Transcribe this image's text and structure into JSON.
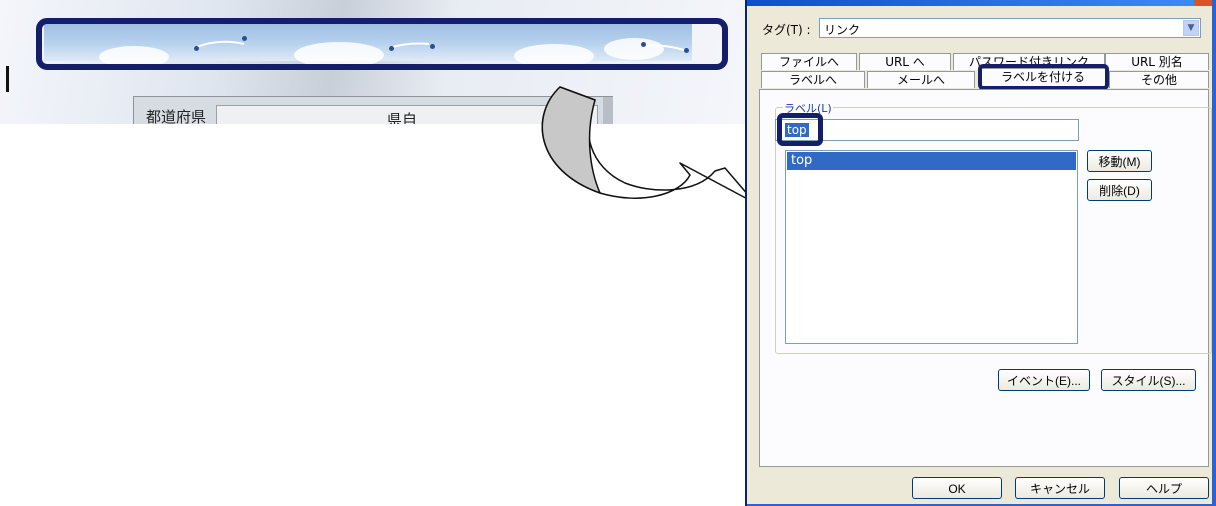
{
  "left_screenshot": {
    "form_header_label": "都道府県",
    "form_value_label": "県自"
  },
  "dialog": {
    "tag_label": "タグ(T) :",
    "tag_value": "リンク",
    "tabs": {
      "row1": [
        "ファイルへ",
        "URL へ",
        "パスワード付きリンク",
        "URL 別名"
      ],
      "row2": [
        "ラベルへ",
        "メールへ",
        "ラベルを付ける",
        "その他"
      ],
      "active": "ラベルを付ける"
    },
    "label_group_title": "ラベル(L)",
    "label_input_value": "top",
    "label_list": [
      "top"
    ],
    "buttons": {
      "move": "移動(M)",
      "delete": "削除(D)",
      "event": "イベント(E)...",
      "style": "スタイル(S)...",
      "ok": "OK",
      "cancel": "キャンセル",
      "help": "ヘルプ"
    }
  },
  "icons": {
    "dropdown": "chevron-down-icon",
    "arrow": "curved-arrow-icon"
  },
  "colors": {
    "highlight_frame": "#141e6a",
    "selection": "#316ac5",
    "dialog_bg": "#ece9d8",
    "title_blue": "#0a52c6"
  }
}
